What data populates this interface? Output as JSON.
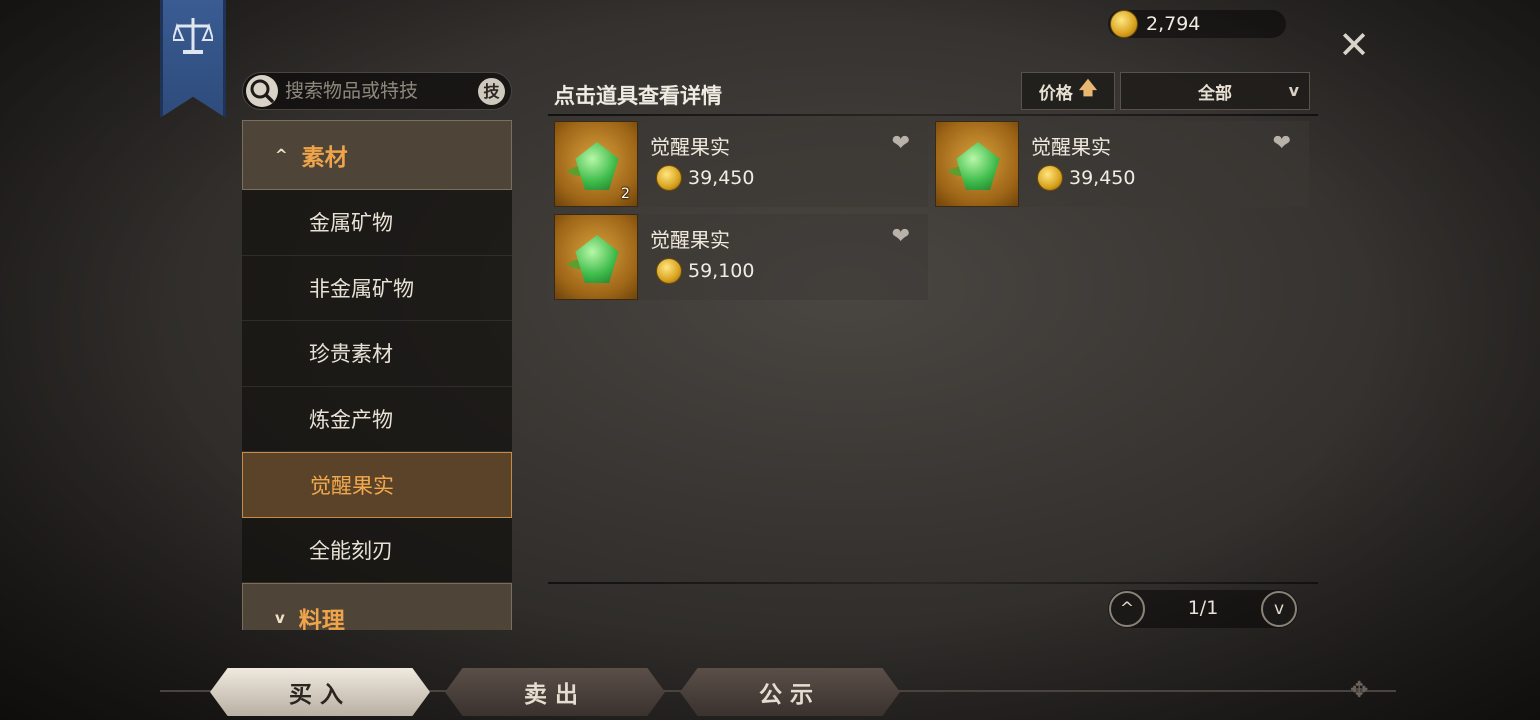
{
  "currency": {
    "amount": "2,794",
    "icon": "gold-coin-icon"
  },
  "search": {
    "placeholder": "搜索物品或特技",
    "skill_button": "技"
  },
  "categories": {
    "group1": {
      "label": "素材",
      "expanded": true
    },
    "items": [
      {
        "label": "金属矿物",
        "active": false
      },
      {
        "label": "非金属矿物",
        "active": false
      },
      {
        "label": "珍贵素材",
        "active": false
      },
      {
        "label": "炼金产物",
        "active": false
      },
      {
        "label": "觉醒果实",
        "active": true
      },
      {
        "label": "全能刻刃",
        "active": false
      }
    ],
    "group2": {
      "label": "料理",
      "expanded": false
    }
  },
  "main": {
    "hint": "点击道具查看详情",
    "sort_label": "价格",
    "filter_label": "全部"
  },
  "listings": [
    {
      "name": "觉醒果实",
      "price": "39,450",
      "qty": "2"
    },
    {
      "name": "觉醒果实",
      "price": "39,450",
      "qty": ""
    },
    {
      "name": "觉醒果实",
      "price": "59,100",
      "qty": ""
    }
  ],
  "pager": {
    "text": "1/1"
  },
  "tabs": [
    {
      "label": "买入",
      "active": true
    },
    {
      "label": "卖出",
      "active": false
    },
    {
      "label": "公示",
      "active": false
    }
  ],
  "colors": {
    "accent": "#f0a44a",
    "active_border": "#c58c43",
    "banner": "#3a5c93"
  }
}
